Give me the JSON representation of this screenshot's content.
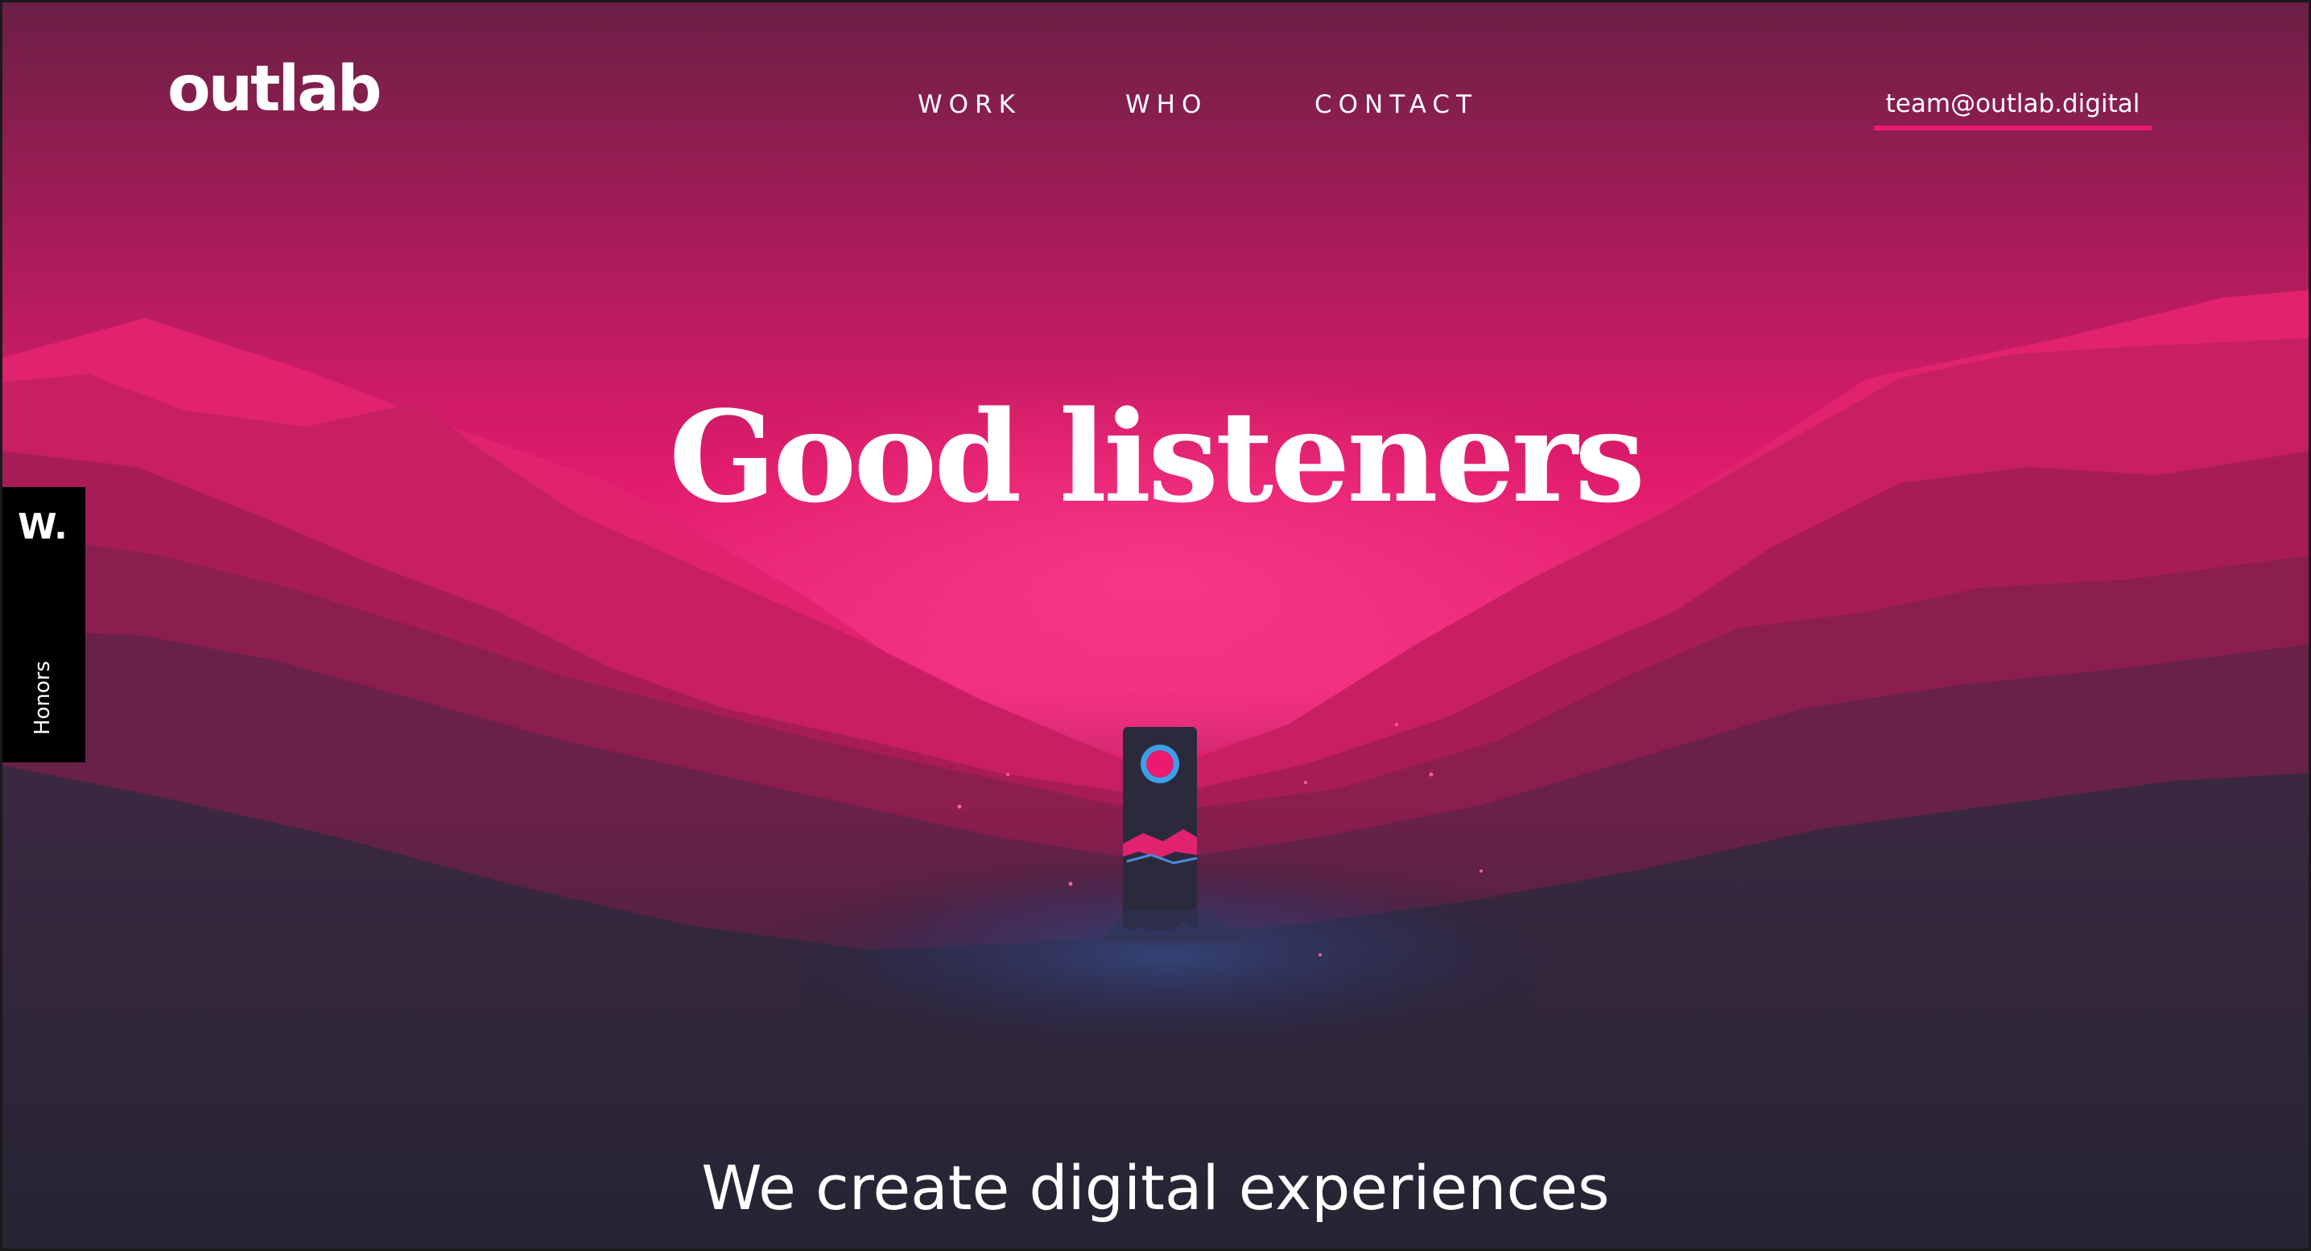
{
  "brand": {
    "logo_text": "outlab"
  },
  "nav": {
    "items": [
      {
        "label": "WORK"
      },
      {
        "label": "WHO"
      },
      {
        "label": "CONTACT"
      }
    ],
    "email": "team@outlab.digital"
  },
  "hero": {
    "title": "Good listeners",
    "tagline": "We create digital experiences"
  },
  "honors_tab": {
    "badge": "W.",
    "label": "Honors"
  },
  "colors": {
    "accent": "#ec1a6e",
    "sky_top": "#6a1f45",
    "sky_glow": "#ec1a6e",
    "ground": "#262433"
  }
}
